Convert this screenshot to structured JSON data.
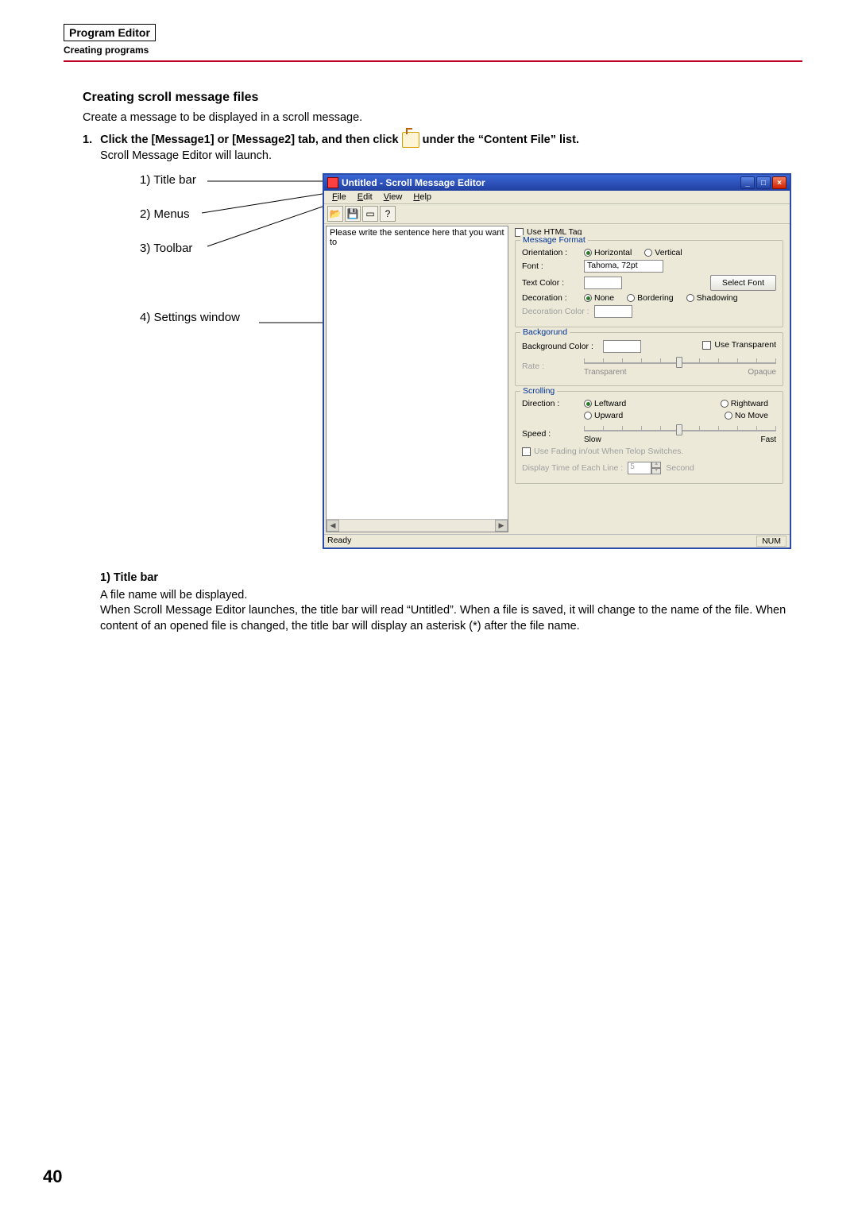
{
  "header": {
    "box": "Program Editor",
    "sub": "Creating programs"
  },
  "section_title": "Creating scroll message files",
  "intro": "Create a message to be displayed in a scroll message.",
  "step1": {
    "num": "1.",
    "part_a": "Click the [Message1] or [Message2] tab, and then click",
    "part_b": "under the “Content File” list.",
    "sub": "Scroll Message Editor will launch."
  },
  "callouts": {
    "c1": "1) Title bar",
    "c2": "2) Menus",
    "c3": "3) Toolbar",
    "c4": "4) Settings window"
  },
  "window": {
    "title": "Untitled - Scroll Message Editor",
    "menus": {
      "file": "File",
      "edit": "Edit",
      "view": "View",
      "help": "Help"
    },
    "edit_placeholder": "Please write the sentence here that you want to",
    "use_html": "Use HTML Tag",
    "grp_msg": "Message Format",
    "orientation_lbl": "Orientation :",
    "orient_h": "Horizontal",
    "orient_v": "Vertical",
    "font_lbl": "Font :",
    "font_val": "Tahoma, 72pt",
    "textcolor_lbl": "Text Color :",
    "select_font": "Select Font",
    "decoration_lbl": "Decoration :",
    "dec_none": "None",
    "dec_border": "Bordering",
    "dec_shadow": "Shadowing",
    "dec_color_lbl": "Decoration Color :",
    "grp_bg": "Backgorund",
    "bgcolor_lbl": "Background Color :",
    "use_transparent": "Use Transparent",
    "rate_lbl": "Rate :",
    "rate_left": "Transparent",
    "rate_right": "Opaque",
    "grp_scroll": "Scrolling",
    "direction_lbl": "Direction :",
    "dir_left": "Leftward",
    "dir_right": "Rightward",
    "dir_up": "Upward",
    "dir_no": "No Move",
    "speed_lbl": "Speed :",
    "speed_left": "Slow",
    "speed_right": "Fast",
    "fading": "Use Fading in/out When Telop Switches.",
    "disp_time_lbl": "Display Time of Each Line :",
    "disp_time_val": "5",
    "disp_time_unit": "Second",
    "status_ready": "Ready",
    "status_num": "NUM"
  },
  "explain": {
    "h": "1) Title bar",
    "p1": "A file name will be displayed.",
    "p2": "When Scroll Message Editor launches, the title bar will read “Untitled”. When a file is saved, it will change to the name of the file. When content of an opened file is changed, the title bar will display an asterisk (*) after the file name."
  },
  "page_number": "40"
}
